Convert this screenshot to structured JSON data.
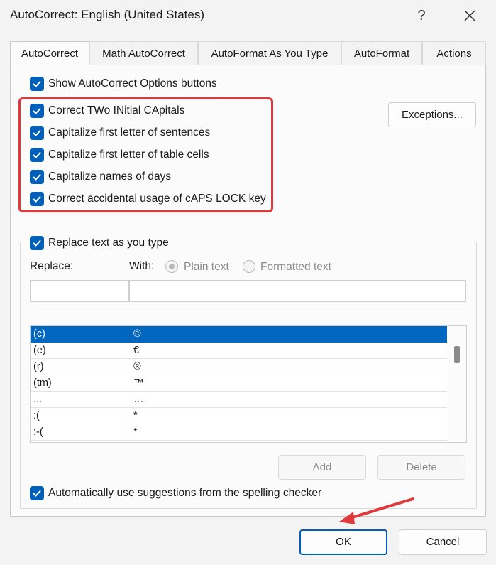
{
  "window": {
    "title": "AutoCorrect: English (United States)",
    "help": "?"
  },
  "tabs": [
    "AutoCorrect",
    "Math AutoCorrect",
    "AutoFormat As You Type",
    "AutoFormat",
    "Actions"
  ],
  "options": {
    "show_buttons": "Show AutoCorrect Options buttons",
    "two_initial": "Correct TWo INitial CApitals",
    "first_sentence": "Capitalize first letter of sentences",
    "first_table": "Capitalize first letter of table cells",
    "names_days": "Capitalize names of days",
    "caps_lock": "Correct accidental usage of cAPS LOCK key",
    "exceptions_label": "Exceptions..."
  },
  "replace_section": {
    "replace_as_type": "Replace text as you type",
    "replace_label": "Replace:",
    "with_label": "With:",
    "plain_text": "Plain text",
    "formatted_text": "Formatted text",
    "replace_value": "",
    "with_value": ""
  },
  "entries": [
    {
      "replace": "(c)",
      "with": "©"
    },
    {
      "replace": "(e)",
      "with": "€"
    },
    {
      "replace": "(r)",
      "with": "®"
    },
    {
      "replace": "(tm)",
      "with": "™"
    },
    {
      "replace": "...",
      "with": "…"
    },
    {
      "replace": ":(",
      "with": "*"
    },
    {
      "replace": ":-(",
      "with": "*"
    }
  ],
  "buttons": {
    "add": "Add",
    "delete": "Delete",
    "ok": "OK",
    "cancel": "Cancel"
  },
  "spelling": "Automatically use suggestions from the spelling checker",
  "colors": {
    "accent": "#005fb8",
    "highlight": "#e0393b",
    "selection": "#0067c0"
  }
}
